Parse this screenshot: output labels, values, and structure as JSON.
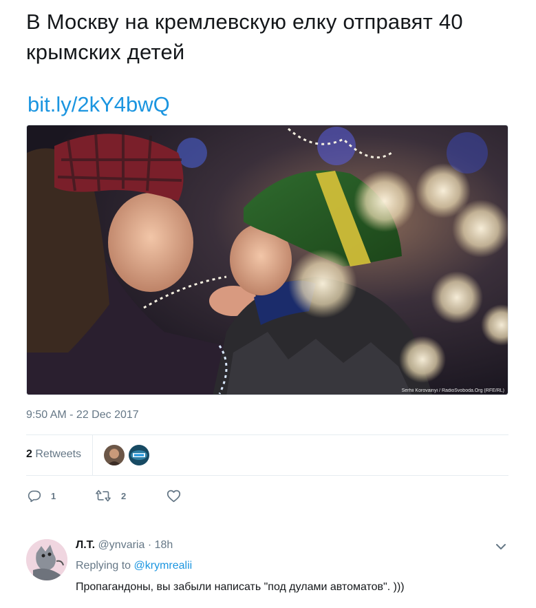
{
  "tweet": {
    "text": "В Москву на кремлевскую елку отправят 40 крымских детей",
    "link": "bit.ly/2kY4bwQ",
    "photo_credit": "Serhii Korovainyi / RadioSvoboda.Org (RFE/RL)",
    "timestamp": "9:50 AM - 22 Dec 2017"
  },
  "stats": {
    "retweet_count": "2",
    "retweet_label": "Retweets"
  },
  "actions": {
    "reply_count": "1",
    "retweet_count": "2",
    "like_count": ""
  },
  "reply": {
    "name": "Л.Т.",
    "handle": "@ynvaria",
    "time": "· 18h",
    "replying_label": "Replying to",
    "replying_to": "@krymrealii",
    "text": "Пропагандоны, вы забыли написать \"под дулами автоматов\". )))"
  },
  "icons": {
    "reply": "reply-icon",
    "retweet": "retweet-icon",
    "like": "heart-icon",
    "more": "chevron-down-icon"
  },
  "colors": {
    "link": "#1b95e0",
    "secondary_text": "#657786",
    "primary_text": "#14171a",
    "divider": "#e6ecf0"
  }
}
